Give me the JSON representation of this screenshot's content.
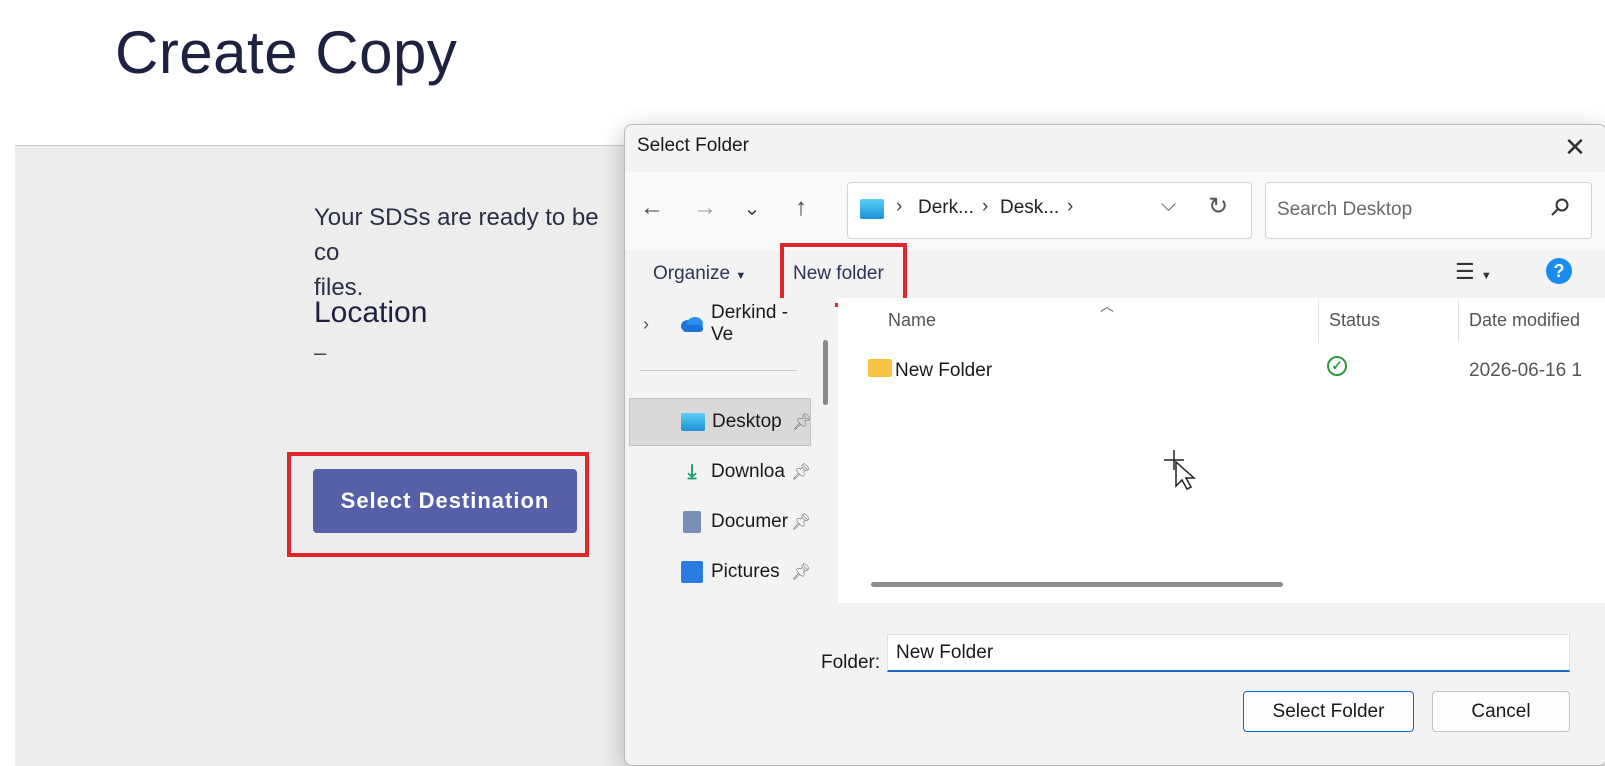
{
  "page": {
    "title": "Create Copy",
    "intro_text": "Your SDSs are ready to be co­files.",
    "intro_line1": "Your SDSs are ready to be co",
    "intro_line2": "files.",
    "location_heading": "Location",
    "location_value": "–",
    "select_destination_label": "Select Destination"
  },
  "dialog": {
    "title": "Select Folder",
    "close_glyph": "✕",
    "nav": {
      "back": "←",
      "forward": "→",
      "recent": "⌄",
      "up": "↑"
    },
    "breadcrumb": [
      "Derk...",
      "Desk..."
    ],
    "search_placeholder": "Search Desktop",
    "toolbar": {
      "organize": "Organize",
      "new_folder": "New folder"
    },
    "nav_pane": [
      {
        "label": "Derkind - Ve",
        "icon": "cloud-icon",
        "pinned": false
      },
      {
        "label": "Desktop",
        "icon": "desktop-icon",
        "pinned": true
      },
      {
        "label": "Downloa",
        "icon": "download-icon",
        "pinned": true
      },
      {
        "label": "Documer",
        "icon": "document-icon",
        "pinned": true
      },
      {
        "label": "Pictures",
        "icon": "pictures-icon",
        "pinned": true
      }
    ],
    "columns": {
      "name": "Name",
      "status": "Status",
      "date": "Date modified"
    },
    "files": [
      {
        "name": "New Folder",
        "status": "synced",
        "date": "2026-06-16 1"
      }
    ],
    "folder_label": "Folder:",
    "folder_value": "New Folder",
    "select_button": "Select Folder",
    "cancel_button": "Cancel"
  },
  "colors": {
    "accent": "#5560a8",
    "highlight": "#e0262d",
    "link_blue": "#1a66c7"
  }
}
